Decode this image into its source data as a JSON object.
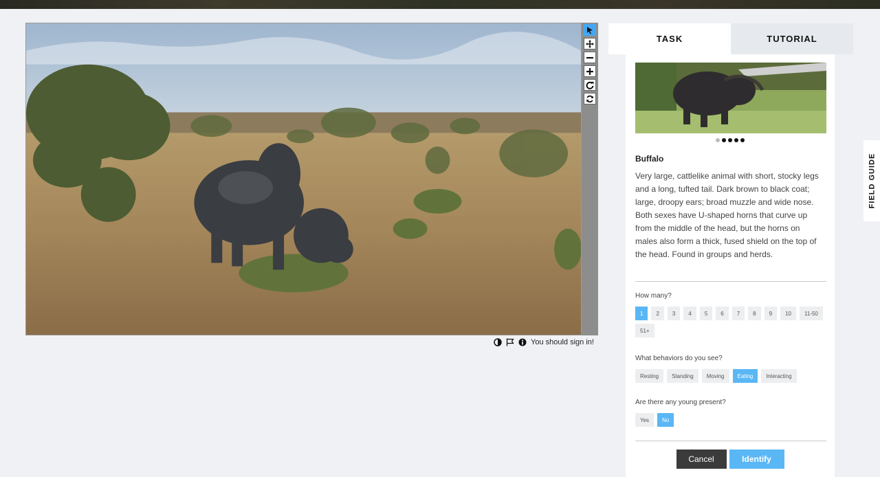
{
  "toolbar": {
    "tools": [
      {
        "name": "pointer",
        "icon": "pointer-icon",
        "active": true
      },
      {
        "name": "pan",
        "icon": "move-icon",
        "active": false
      },
      {
        "name": "zoom-out",
        "icon": "minus-icon",
        "active": false
      },
      {
        "name": "zoom-in",
        "icon": "plus-icon",
        "active": false
      },
      {
        "name": "rotate",
        "icon": "rotate-icon",
        "active": false
      },
      {
        "name": "reset",
        "icon": "refresh-icon",
        "active": false
      }
    ]
  },
  "meta": {
    "sign_in_text": "You should sign in!"
  },
  "tabs": {
    "task": "TASK",
    "tutorial": "TUTORIAL"
  },
  "animal": {
    "name": "Buffalo",
    "description": "Very large, cattlelike animal with short, stocky legs and a long, tufted tail. Dark brown to black coat; large, droopy ears; broad muzzle and wide nose. Both sexes have U-shaped horns that curve up from the middle of the head, but the horns on males also form a thick, fused shield on the top of the head. Found in groups and herds."
  },
  "questions": {
    "how_many": {
      "label": "How many?",
      "options": [
        "1",
        "2",
        "3",
        "4",
        "5",
        "6",
        "7",
        "8",
        "9",
        "10",
        "11-50",
        "51+"
      ],
      "selected": "1"
    },
    "behaviors": {
      "label": "What behaviors do you see?",
      "options": [
        "Resting",
        "Standing",
        "Moving",
        "Eating",
        "Interacting"
      ],
      "selected": "Eating"
    },
    "young": {
      "label": "Are there any young present?",
      "options": [
        "Yes",
        "No"
      ],
      "selected": "No"
    }
  },
  "buttons": {
    "cancel": "Cancel",
    "identify": "Identify"
  },
  "field_guide": "FIELD GUIDE",
  "colors": {
    "accent": "#5ab7f5",
    "tool_active": "#43a8f4",
    "cancel_bg": "#3b3b3b"
  }
}
